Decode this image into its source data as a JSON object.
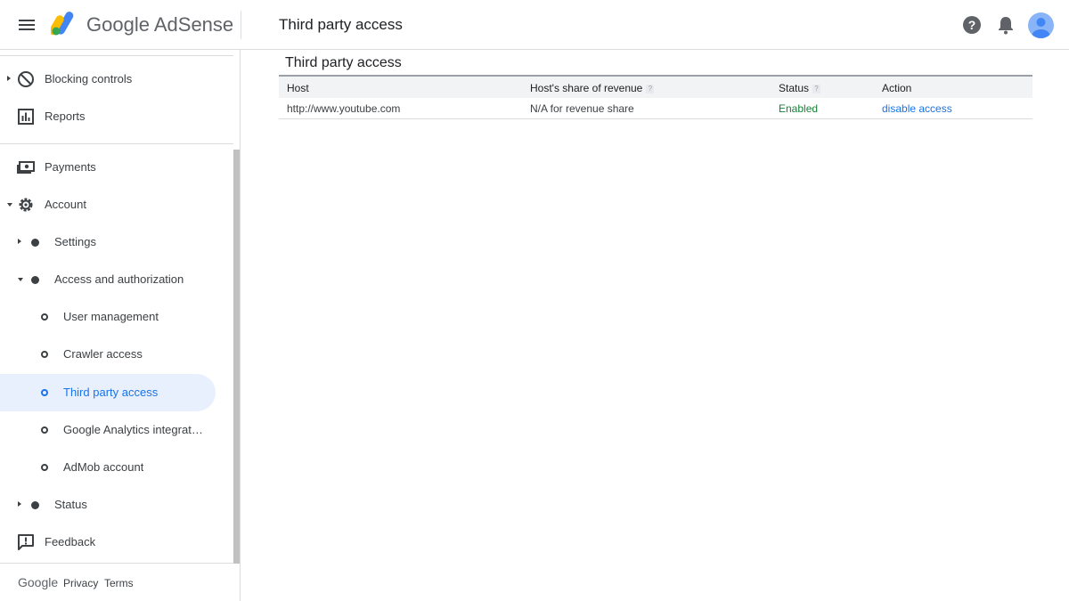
{
  "header": {
    "brand_google": "Google",
    "brand_product": "AdSense",
    "title": "Third party access",
    "icons": [
      "menu-icon",
      "adsense-logo",
      "help-icon",
      "notifications-icon",
      "avatar"
    ]
  },
  "sidebar": {
    "items": [
      {
        "label": "Blocking controls",
        "icon": "block-icon",
        "caret": "right"
      },
      {
        "label": "Reports",
        "icon": "bar-chart-icon"
      },
      {
        "label": "Payments",
        "icon": "payments-icon"
      },
      {
        "label": "Account",
        "icon": "gear-icon",
        "caret": "down"
      },
      {
        "label": "Settings",
        "caret": "right"
      },
      {
        "label": "Access and authorization",
        "caret": "down"
      },
      {
        "label": "User management"
      },
      {
        "label": "Crawler access"
      },
      {
        "label": "Third party access",
        "active": true
      },
      {
        "label": "Google Analytics integration"
      },
      {
        "label": "AdMob account"
      },
      {
        "label": "Status",
        "caret": "right"
      },
      {
        "label": "Feedback",
        "icon": "feedback-icon"
      }
    ],
    "footer": {
      "google": "Google",
      "privacy": "Privacy",
      "terms": "Terms"
    }
  },
  "main": {
    "section_title": "Third party access",
    "table": {
      "headers": {
        "host": "Host",
        "share": "Host's share of revenue",
        "status": "Status",
        "action": "Action"
      },
      "help_mark": "?",
      "rows": [
        {
          "host": "http://www.youtube.com",
          "share": "N/A for revenue share",
          "status": "Enabled",
          "action": "disable access"
        }
      ]
    }
  },
  "colors": {
    "accent": "#1a73e8",
    "enabled": "#188038",
    "active_bg": "#e8f0fe"
  }
}
